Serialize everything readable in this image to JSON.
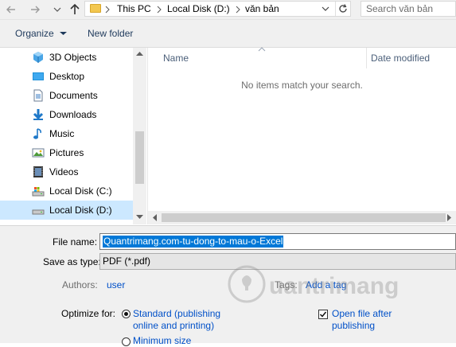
{
  "address_bar": {
    "breadcrumbs": [
      "This PC",
      "Local Disk (D:)",
      "văn bản"
    ],
    "search_placeholder": "Search văn bản"
  },
  "command_bar": {
    "organize_label": "Organize",
    "new_folder_label": "New folder"
  },
  "nav_pane": {
    "items": [
      {
        "label": "3D Objects",
        "icon": "3d-objects-icon"
      },
      {
        "label": "Desktop",
        "icon": "desktop-icon"
      },
      {
        "label": "Documents",
        "icon": "documents-icon"
      },
      {
        "label": "Downloads",
        "icon": "downloads-icon"
      },
      {
        "label": "Music",
        "icon": "music-icon"
      },
      {
        "label": "Pictures",
        "icon": "pictures-icon"
      },
      {
        "label": "Videos",
        "icon": "videos-icon"
      },
      {
        "label": "Local Disk (C:)",
        "icon": "drive-c-icon"
      },
      {
        "label": "Local Disk (D:)",
        "icon": "drive-d-icon",
        "selected": true
      }
    ]
  },
  "file_list": {
    "columns": [
      "Name",
      "Date modified"
    ],
    "empty_message": "No items match your search."
  },
  "save_form": {
    "file_name_label": "File name:",
    "file_name_value": "Quantrimang.com-tu-dong-to-mau-o-Excel",
    "save_as_type_label": "Save as type:",
    "save_as_type_value": "PDF (*.pdf)",
    "authors_label": "Authors:",
    "authors_value": "user",
    "tags_label": "Tags:",
    "tags_value": "Add a tag",
    "optimize_label": "Optimize for:",
    "optimize_standard": "Standard (publishing\nonline and printing)",
    "optimize_minimum": "Minimum size",
    "open_after_label": "Open file after\npublishing",
    "open_after_checked": true
  },
  "colors": {
    "selection": "#0078d7",
    "nav_selected": "#cce8ff",
    "link": "#0050c8"
  }
}
